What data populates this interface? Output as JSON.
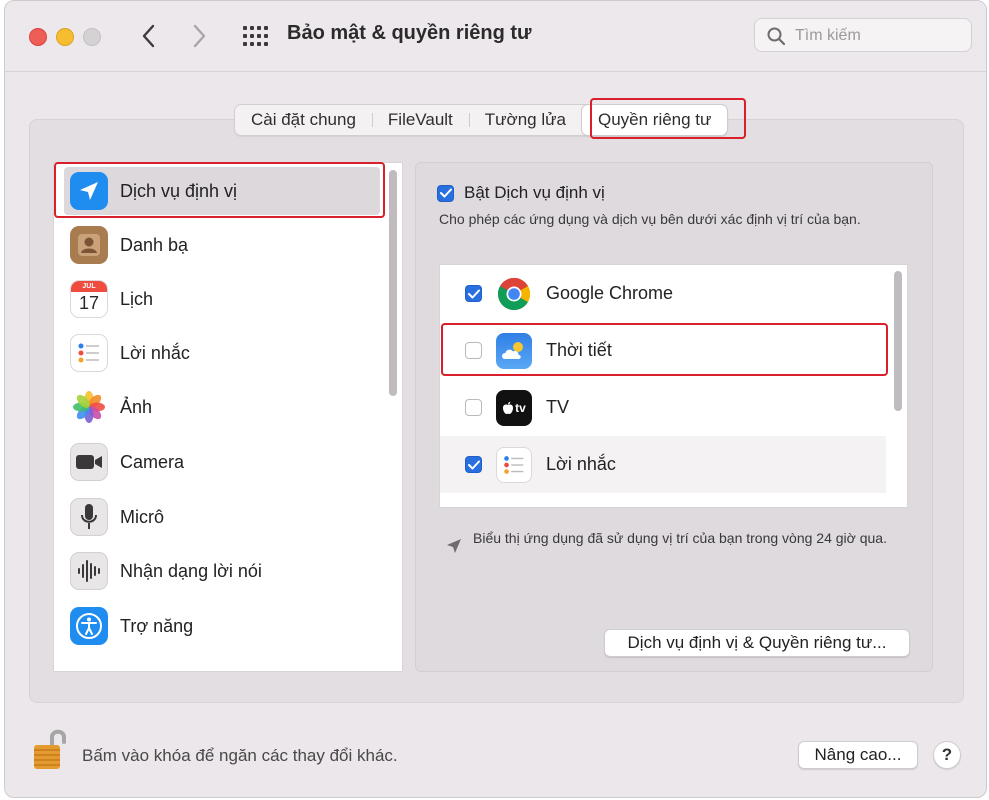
{
  "window": {
    "title": "Bảo mật & quyền riêng tư",
    "search_placeholder": "Tìm kiếm"
  },
  "tabs": [
    {
      "label": "Cài đặt chung",
      "active": false
    },
    {
      "label": "FileVault",
      "active": false
    },
    {
      "label": "Tường lửa",
      "active": false
    },
    {
      "label": "Quyền riêng tư",
      "active": true
    }
  ],
  "sidebar": {
    "items": [
      {
        "label": "Dịch vụ định vị",
        "icon": "location-arrow-icon",
        "selected": true
      },
      {
        "label": "Danh bạ",
        "icon": "contacts-icon",
        "selected": false
      },
      {
        "label": "Lịch",
        "icon": "calendar-icon",
        "selected": false,
        "calendar_month": "JUL",
        "calendar_day": "17"
      },
      {
        "label": "Lời nhắc",
        "icon": "reminders-icon",
        "selected": false
      },
      {
        "label": "Ảnh",
        "icon": "photos-icon",
        "selected": false
      },
      {
        "label": "Camera",
        "icon": "camera-icon",
        "selected": false
      },
      {
        "label": "Micrô",
        "icon": "microphone-icon",
        "selected": false
      },
      {
        "label": "Nhận dạng lời nói",
        "icon": "speech-recognition-icon",
        "selected": false
      },
      {
        "label": "Trợ năng",
        "icon": "accessibility-icon",
        "selected": false
      }
    ]
  },
  "location": {
    "enable_label": "Bật Dịch vụ định vị",
    "enable_checked": true,
    "description": "Cho phép các ứng dụng và dịch vụ bên dưới xác định vị trí của bạn.",
    "apps": [
      {
        "name": "Google Chrome",
        "checked": true,
        "icon": "chrome-icon"
      },
      {
        "name": "Thời tiết",
        "checked": false,
        "icon": "weather-icon"
      },
      {
        "name": "TV",
        "checked": false,
        "icon": "apple-tv-icon",
        "icon_text": "tv"
      },
      {
        "name": "Lời nhắc",
        "checked": true,
        "icon": "reminders-icon"
      }
    ],
    "recent_note": "Biểu thị ứng dụng đã sử dụng vị trí của bạn trong vòng 24 giờ qua.",
    "details_button": "Dịch vụ định vị & Quyền riêng tư..."
  },
  "footer": {
    "lock_text": "Bấm vào khóa để ngăn các thay đổi khác.",
    "advanced_button": "Nâng cao...",
    "help_label": "?"
  },
  "colors": {
    "accent_blue": "#2a6fe0",
    "highlight_red": "#d91f2b"
  }
}
